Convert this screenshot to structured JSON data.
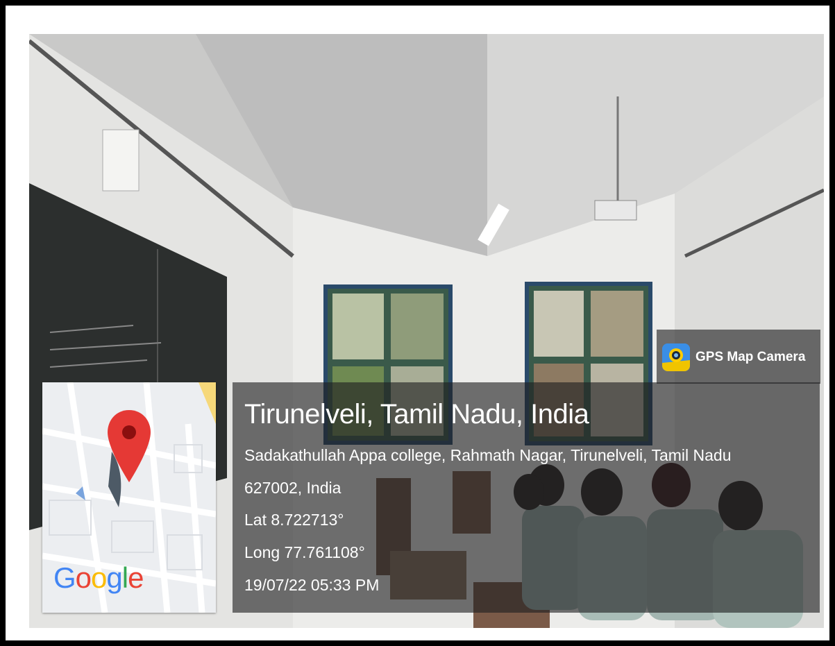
{
  "map": {
    "logo": "Google",
    "pin_icon": "location-pin-icon"
  },
  "badge": {
    "label": "GPS Map Camera",
    "icon": "gps-map-camera-icon"
  },
  "info": {
    "title": "Tirunelveli, Tamil Nadu, India",
    "address_line_1": "Sadakathullah Appa college, Rahmath Nagar, Tirunelveli, Tamil Nadu",
    "address_line_2": "627002, India",
    "latitude": "Lat 8.722713°",
    "longitude": "Long 77.761108°",
    "datetime": "19/07/22 05:33 PM"
  },
  "colors": {
    "pin": "#e53935",
    "overlay": "#1e1e20",
    "logo_blue": "#4285F4",
    "logo_red": "#EA4335",
    "logo_yellow": "#FBBC05",
    "logo_green": "#34A853"
  }
}
